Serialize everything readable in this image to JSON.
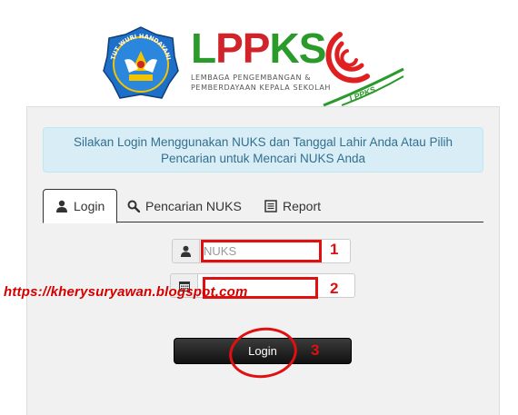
{
  "header": {
    "brand_l": "L",
    "brand_pp": "PP",
    "brand_ks": "KS",
    "brand_line1": "LEMBAGA PENGEMBANGAN &",
    "brand_line2": "PEMBERDAYAAN KEPALA SEKOLAH",
    "emblem_text": "TUT WURI HANDAYANI",
    "swirl_text": "LPPKS"
  },
  "alert": {
    "line1": "Silakan Login Menggunakan NUKS dan Tanggal Lahir Anda Atau Pilih",
    "line2": "Pencarian untuk Mencari NUKS Anda"
  },
  "tabs": [
    {
      "label": "Login",
      "icon": "user-icon",
      "active": true
    },
    {
      "label": "Pencarian NUKS",
      "icon": "search-icon",
      "active": false
    },
    {
      "label": "Report",
      "icon": "list-icon",
      "active": false
    }
  ],
  "form": {
    "nuks_placeholder": "NUKS",
    "nuks_value": "",
    "date_value": "",
    "login_label": "Login"
  },
  "annotations": {
    "n1": "1",
    "n2": "2",
    "n3": "3"
  },
  "watermark": "https://kherysuryawan.blogspot.com",
  "colors": {
    "alert_bg": "#d9edf7",
    "alert_text": "#31708f",
    "annotation_red": "#e01010",
    "button_dark": "#222222"
  }
}
